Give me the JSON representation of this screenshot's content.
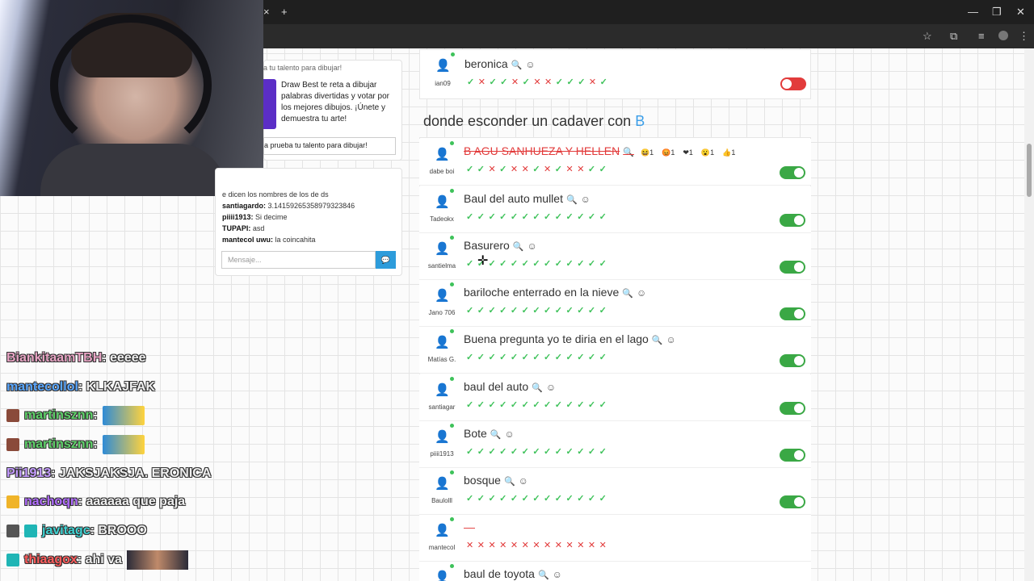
{
  "browser": {
    "tab_close": "×",
    "new_tab": "+",
    "window_minimize": "—",
    "window_restore": "❐",
    "window_close": "✕",
    "icons": [
      "star-icon",
      "extension-icon",
      "media-icon",
      "profile-icon",
      "menu-icon"
    ]
  },
  "promo": {
    "title": "a tu talento para dibujar!",
    "text": "Draw Best te reta a dibujar palabras divertidas y votar por los mejores dibujos. ¡Únete y demuestra tu arte!",
    "button": "a prueba tu talento para dibujar!"
  },
  "game_chat": {
    "messages": [
      {
        "user": "",
        "text": "e dicen los nombres de los de ds"
      },
      {
        "user": "santiagardo:",
        "text": " 3.14159265358979323846"
      },
      {
        "user": "piiii1913:",
        "text": " Si decime"
      },
      {
        "user": "TUPAPI:",
        "text": " asd"
      },
      {
        "user": "mantecol uwu:",
        "text": " la coincahita"
      }
    ],
    "input_placeholder": "Mensaje...",
    "send_icon": "💬"
  },
  "stream_chat": [
    {
      "user": "BiankitaamTBH",
      "color": "#e8a4c4",
      "text": ": eeeee"
    },
    {
      "user": "mantecollol",
      "color": "#5aa7ff",
      "text": ": KLKAJFAK"
    },
    {
      "user": "martinsznn",
      "color": "#5fd36a",
      "text": ":",
      "emote": true
    },
    {
      "user": "martinsznn",
      "color": "#5fd36a",
      "text": ":",
      "emote": true
    },
    {
      "user": "Pii1913",
      "color": "#c49bff",
      "text": ": JAKSJAKSJA. ERONICA"
    },
    {
      "user": "nachoqn",
      "color": "#b16cff",
      "text": ": aaaaaa que paja"
    },
    {
      "user": "javitagc",
      "color": "#3ed3d3",
      "text": ": BROOO"
    },
    {
      "user": "thiaagox",
      "color": "#ff5b5b",
      "text": ": ahi va",
      "emote_dark": true
    }
  ],
  "topic": {
    "prefix": "donde esconder un cadaver con ",
    "letter": "B"
  },
  "first_entry": {
    "answer": "beronica",
    "user": "ian09",
    "votes": "✓✕✓✓✕✓✕✕✓✓✓✕✓",
    "accepted": false
  },
  "entries": [
    {
      "answer": "B AGU SANHUEZA Y HELLEN",
      "user": "dabe boi",
      "votes": "✓✓✕✓✕✕✓✕✓✕✕✓✓",
      "accepted": true,
      "strike": true,
      "reactions": [
        "😆1",
        "😡1",
        "❤1",
        "😮1",
        "👍1"
      ]
    },
    {
      "answer": "Baul del auto mullet",
      "user": "Tadeokx",
      "votes": "✓✓✓✓✓✓✓✓✓✓✓✓✓",
      "accepted": true
    },
    {
      "answer": "Basurero",
      "user": "santielma",
      "votes": "✓✓✓✓✓✓✓✓✓✓✓✓✓",
      "accepted": true
    },
    {
      "answer": "bariloche enterrado en la nieve",
      "user": "Jano 706",
      "votes": "✓✓✓✓✓✓✓✓✓✓✓✓✓",
      "accepted": true
    },
    {
      "answer": "Buena pregunta yo te diria en el lago",
      "user": "Matías G.",
      "votes": "✓✓✓✓✓✓✓✓✓✓✓✓✓",
      "accepted": true
    },
    {
      "answer": "baul del auto",
      "user": "santiagar",
      "votes": "✓✓✓✓✓✓✓✓✓✓✓✓✓",
      "accepted": true
    },
    {
      "answer": "Bote",
      "user": "piiii1913",
      "votes": "✓✓✓✓✓✓✓✓✓✓✓✓✓",
      "accepted": true
    },
    {
      "answer": "bosque",
      "user": "Baulolll",
      "votes": "✓✓✓✓✓✓✓✓✓✓✓✓✓",
      "accepted": true
    },
    {
      "answer": "—",
      "user": "mantecol",
      "votes": "✕✕✕✕✕✕✕✕✕✕✕✕✕",
      "accepted": null,
      "empty": true
    },
    {
      "answer": "baul de toyota",
      "user": "",
      "votes": "",
      "accepted": null
    }
  ],
  "icons": {
    "magnifier": "🔍",
    "smile": "☺",
    "user": "👤"
  }
}
